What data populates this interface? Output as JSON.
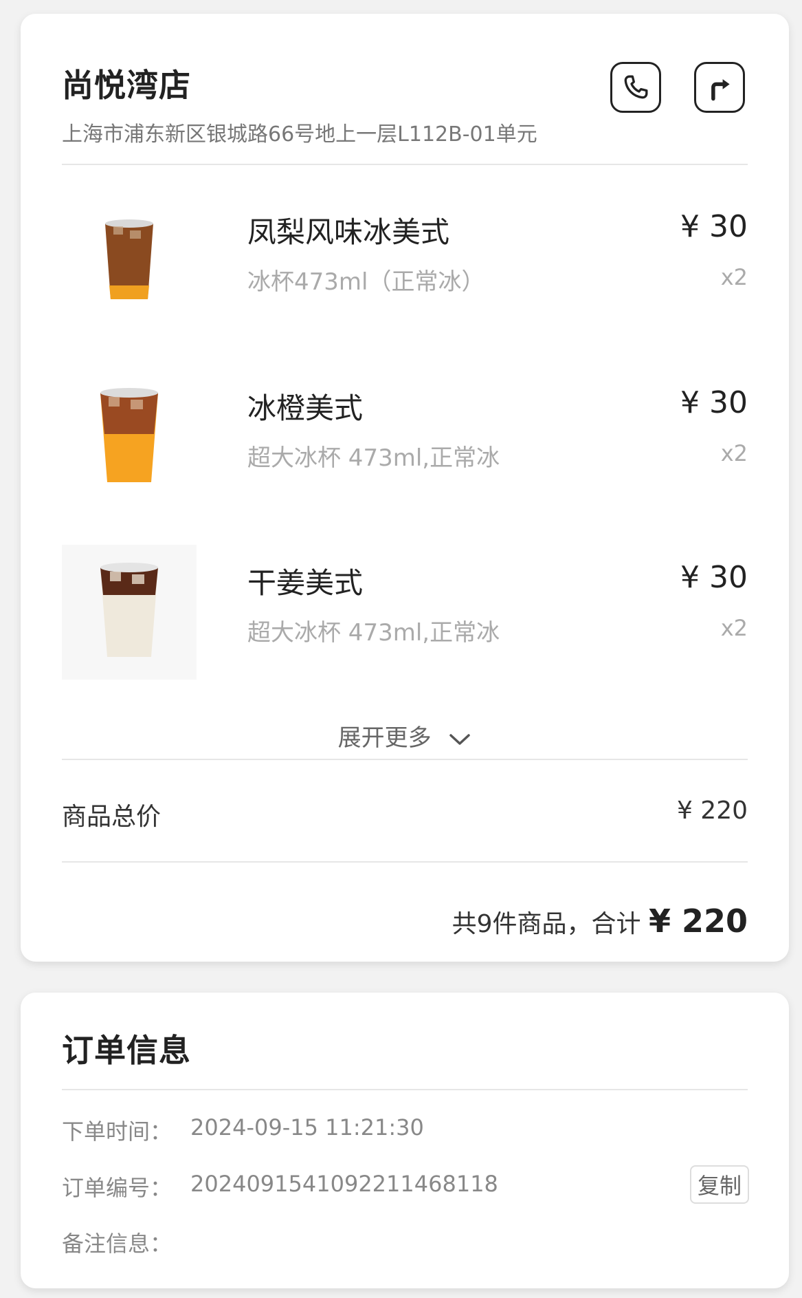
{
  "store": {
    "name": "尚悦湾店",
    "address": "上海市浦东新区银城路66号地上一层L112B-01单元"
  },
  "items": [
    {
      "name": "凤梨风味冰美式",
      "spec": "冰杯473ml（正常冰）",
      "price": "¥ 30",
      "qty": "x2"
    },
    {
      "name": "冰橙美式",
      "spec": "超大冰杯 473ml,正常冰",
      "price": "¥ 30",
      "qty": "x2"
    },
    {
      "name": "干姜美式",
      "spec": "超大冰杯 473ml,正常冰",
      "price": "¥ 30",
      "qty": "x2"
    }
  ],
  "expand_label": "展开更多",
  "subtotal": {
    "label": "商品总价",
    "value": "¥ 220"
  },
  "summary": {
    "prefix": "共9件商品，合计",
    "total": "¥ 220"
  },
  "order": {
    "title": "订单信息",
    "time_label": "下单时间：",
    "time_value": "2024-09-15 11:21:30",
    "number_label": "订单编号：",
    "number_value": "2024091541092211468118",
    "copy_label": "复制",
    "note_label": "备注信息："
  },
  "icons": {
    "phone": "phone-icon",
    "navigate": "turn-right-arrow-icon",
    "expand": "chevron-down-icon"
  },
  "colors": {
    "background": "#f2f2f2",
    "card": "#ffffff",
    "muted_text": "#aaaaaa"
  }
}
